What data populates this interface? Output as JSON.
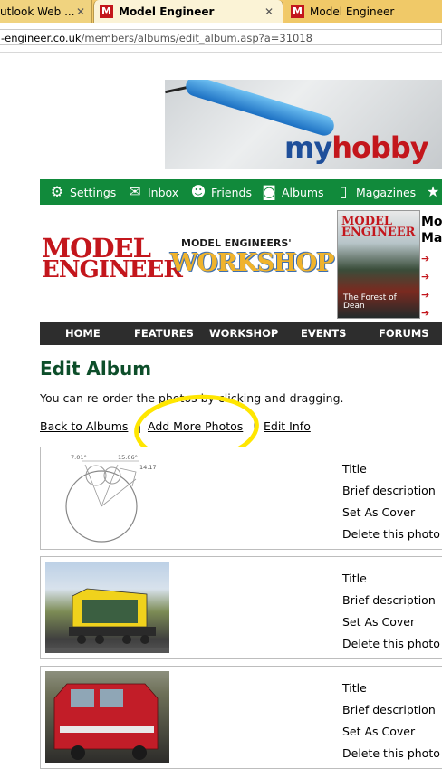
{
  "browser": {
    "tabs": [
      {
        "label": "utlook Web ...",
        "close": "✕"
      },
      {
        "label": "Model Engineer",
        "close": "✕",
        "favicon": "M"
      },
      {
        "label": "Model Engineer",
        "favicon": "M"
      }
    ],
    "url": {
      "prefix": "-engineer.co.uk",
      "path": "/members/albums/edit_album.asp?a=31018"
    }
  },
  "ad": {
    "brand_part1": "my",
    "brand_part2": "hobby",
    "brand_colors": [
      "#1f4f9a",
      "#c3161c"
    ]
  },
  "green_nav": {
    "items": [
      {
        "label": "Settings",
        "icon": "gear-icon"
      },
      {
        "label": "Inbox",
        "icon": "envelope-icon"
      },
      {
        "label": "Friends",
        "icon": "people-icon"
      },
      {
        "label": "Albums",
        "icon": "camera-icon"
      },
      {
        "label": "Magazines",
        "icon": "book-icon"
      },
      {
        "label": "",
        "icon": "star-icon"
      }
    ]
  },
  "header": {
    "me_logo_line1": "MODEL",
    "me_logo_line2": "ENGINEER",
    "mew_line1": "MODEL ENGINEERS'",
    "mew_line2": "WORKSHOP",
    "cover_title_line1": "MODEL",
    "cover_title_line2": "ENGINEER",
    "cover_subtitle": "The Forest of Dean",
    "mag_side_line1": "Mo",
    "mag_side_line2": "Ma"
  },
  "dark_nav": {
    "items": [
      "HOME",
      "FEATURES",
      "WORKSHOP",
      "EVENTS",
      "FORUMS"
    ]
  },
  "content": {
    "title": "Edit Album",
    "intro": "You can re-order the photos by clicking and dragging.",
    "links": {
      "back": "Back to Albums",
      "add": "Add More Photos",
      "edit": "Edit Info",
      "separator": "|"
    }
  },
  "photo_actions": [
    "Title",
    "Brief description",
    "Set As Cover",
    "Delete this photo"
  ],
  "photos": [
    {
      "kind": "drawing",
      "dims": [
        "7.01°",
        "15.06°",
        "14.17"
      ]
    },
    {
      "kind": "locomotive"
    },
    {
      "kind": "red van"
    }
  ],
  "colors": {
    "green_nav": "#118a3b",
    "dark_nav": "#2d2d2d",
    "title": "#0d4e2a",
    "highlight": "#ffe600",
    "brand_red": "#c3161c"
  }
}
